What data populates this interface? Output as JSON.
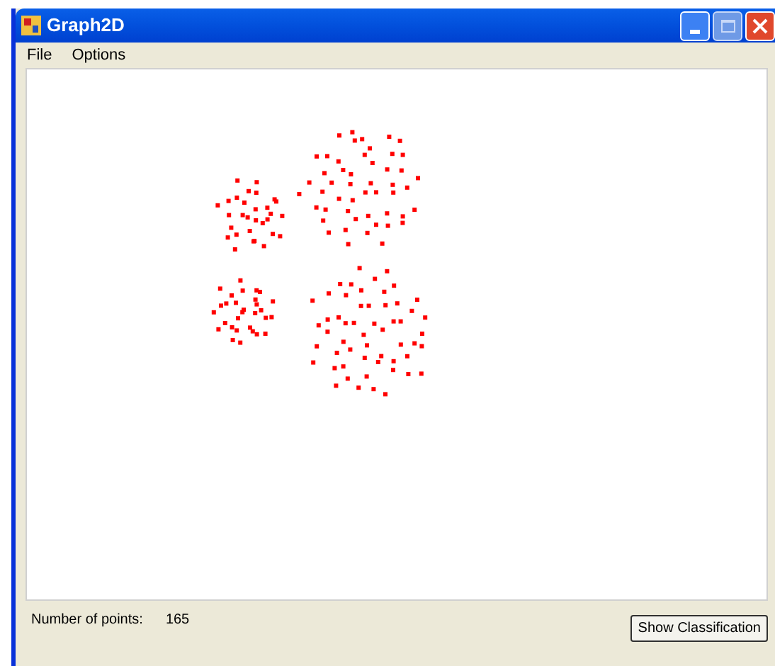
{
  "window": {
    "title": "Graph2D"
  },
  "menu": [
    {
      "label": "File"
    },
    {
      "label": "Options"
    }
  ],
  "status": {
    "label": "Number of points:",
    "value": "165"
  },
  "buttons": [
    {
      "label": "Show Classification"
    }
  ]
}
